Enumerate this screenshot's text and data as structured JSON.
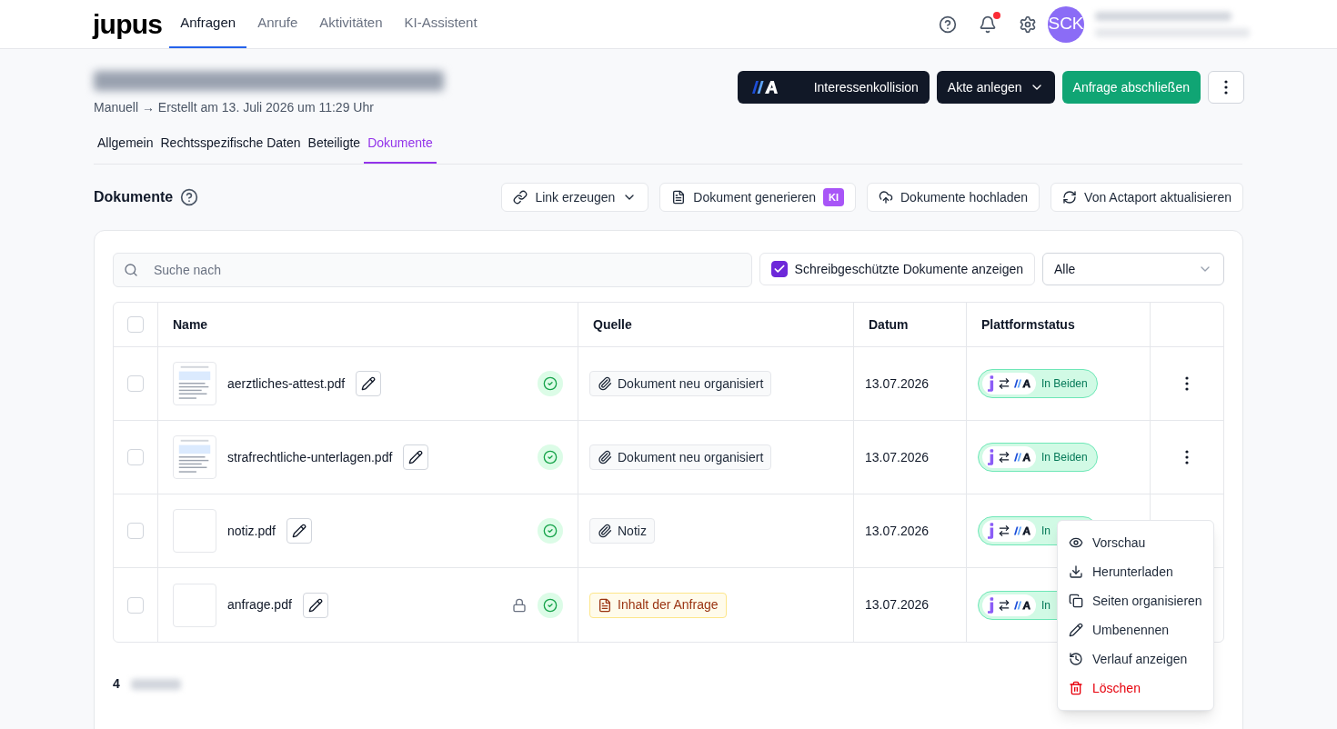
{
  "app": {
    "logo": "jupus",
    "nav": [
      {
        "label": "Anfragen",
        "selected": true
      },
      {
        "label": "Anrufe",
        "selected": false
      },
      {
        "label": "Aktivitäten",
        "selected": false
      },
      {
        "label": "KI-Assistent",
        "selected": false
      }
    ],
    "notifications_unread": true,
    "avatar": "SCK"
  },
  "header": {
    "subtitle": "Manuell → Erstellt am 13. Juli 2026 um 11:29 Uhr",
    "actions": [
      {
        "kind": "logo",
        "label": "Interessenkollision"
      },
      {
        "kind": "dropdown",
        "label": "Akte anlegen"
      },
      {
        "kind": "primary",
        "label": "Anfrage abschließen"
      },
      {
        "kind": "more"
      }
    ]
  },
  "tabs": [
    {
      "label": "Allgemein",
      "selected": false
    },
    {
      "label": "Rechtsspezifische Daten",
      "selected": false
    },
    {
      "label": "Beteiligte",
      "selected": false
    },
    {
      "label": "Dokumente",
      "selected": true
    }
  ],
  "section": {
    "title": "Dokumente",
    "buttons": [
      {
        "kind": "link",
        "label": "Link erzeugen"
      },
      {
        "kind": "generate",
        "label": "Dokument generieren",
        "badge": "KI"
      },
      {
        "kind": "upload",
        "label": "Dokumente hochladen"
      },
      {
        "kind": "sync",
        "label": "Von Actaport aktualisieren"
      }
    ]
  },
  "filters": {
    "search_placeholder": "Suche nach",
    "readonly": {
      "label": "Schreibgeschützte Dokumente anzeigen",
      "checked": true
    },
    "select": "Alle"
  },
  "table": {
    "select_all_checked": false,
    "columns": [
      "Name",
      "Quelle",
      "Datum",
      "Plattformstatus"
    ],
    "rows": [
      {
        "checked": false,
        "thumbnail": {
          "kind": "document"
        },
        "name": "aerztliches-attest.pdf",
        "locked": false,
        "source": {
          "kind": "attachment",
          "label": "Dokument neu organisiert"
        },
        "date": "13.07.2026",
        "status": "In Beiden"
      },
      {
        "checked": false,
        "thumbnail": {
          "kind": "document"
        },
        "name": "strafrechtliche-unterlagen.pdf",
        "locked": false,
        "source": {
          "kind": "attachment",
          "label": "Dokument neu organisiert"
        },
        "date": "13.07.2026",
        "status": "In Beiden"
      },
      {
        "checked": false,
        "thumbnail": {
          "kind": "blank"
        },
        "name": "notiz.pdf",
        "locked": false,
        "source": {
          "kind": "attachment",
          "label": "Notiz"
        },
        "date": "13.07.2026",
        "status": "In"
      },
      {
        "checked": false,
        "thumbnail": {
          "kind": "blank"
        },
        "name": "anfrage.pdf",
        "locked": true,
        "source": {
          "kind": "request",
          "label": "Inhalt der Anfrage"
        },
        "date": "13.07.2026",
        "status": "In"
      }
    ]
  },
  "count": "4",
  "context_menu": [
    {
      "kind": "preview",
      "label": "Vorschau"
    },
    {
      "kind": "download",
      "label": "Herunterladen"
    },
    {
      "kind": "pages",
      "label": "Seiten organisieren"
    },
    {
      "kind": "rename",
      "label": "Umbenennen"
    },
    {
      "kind": "history",
      "label": "Verlauf anzeigen"
    },
    {
      "kind": "delete",
      "label": "Löschen"
    }
  ]
}
